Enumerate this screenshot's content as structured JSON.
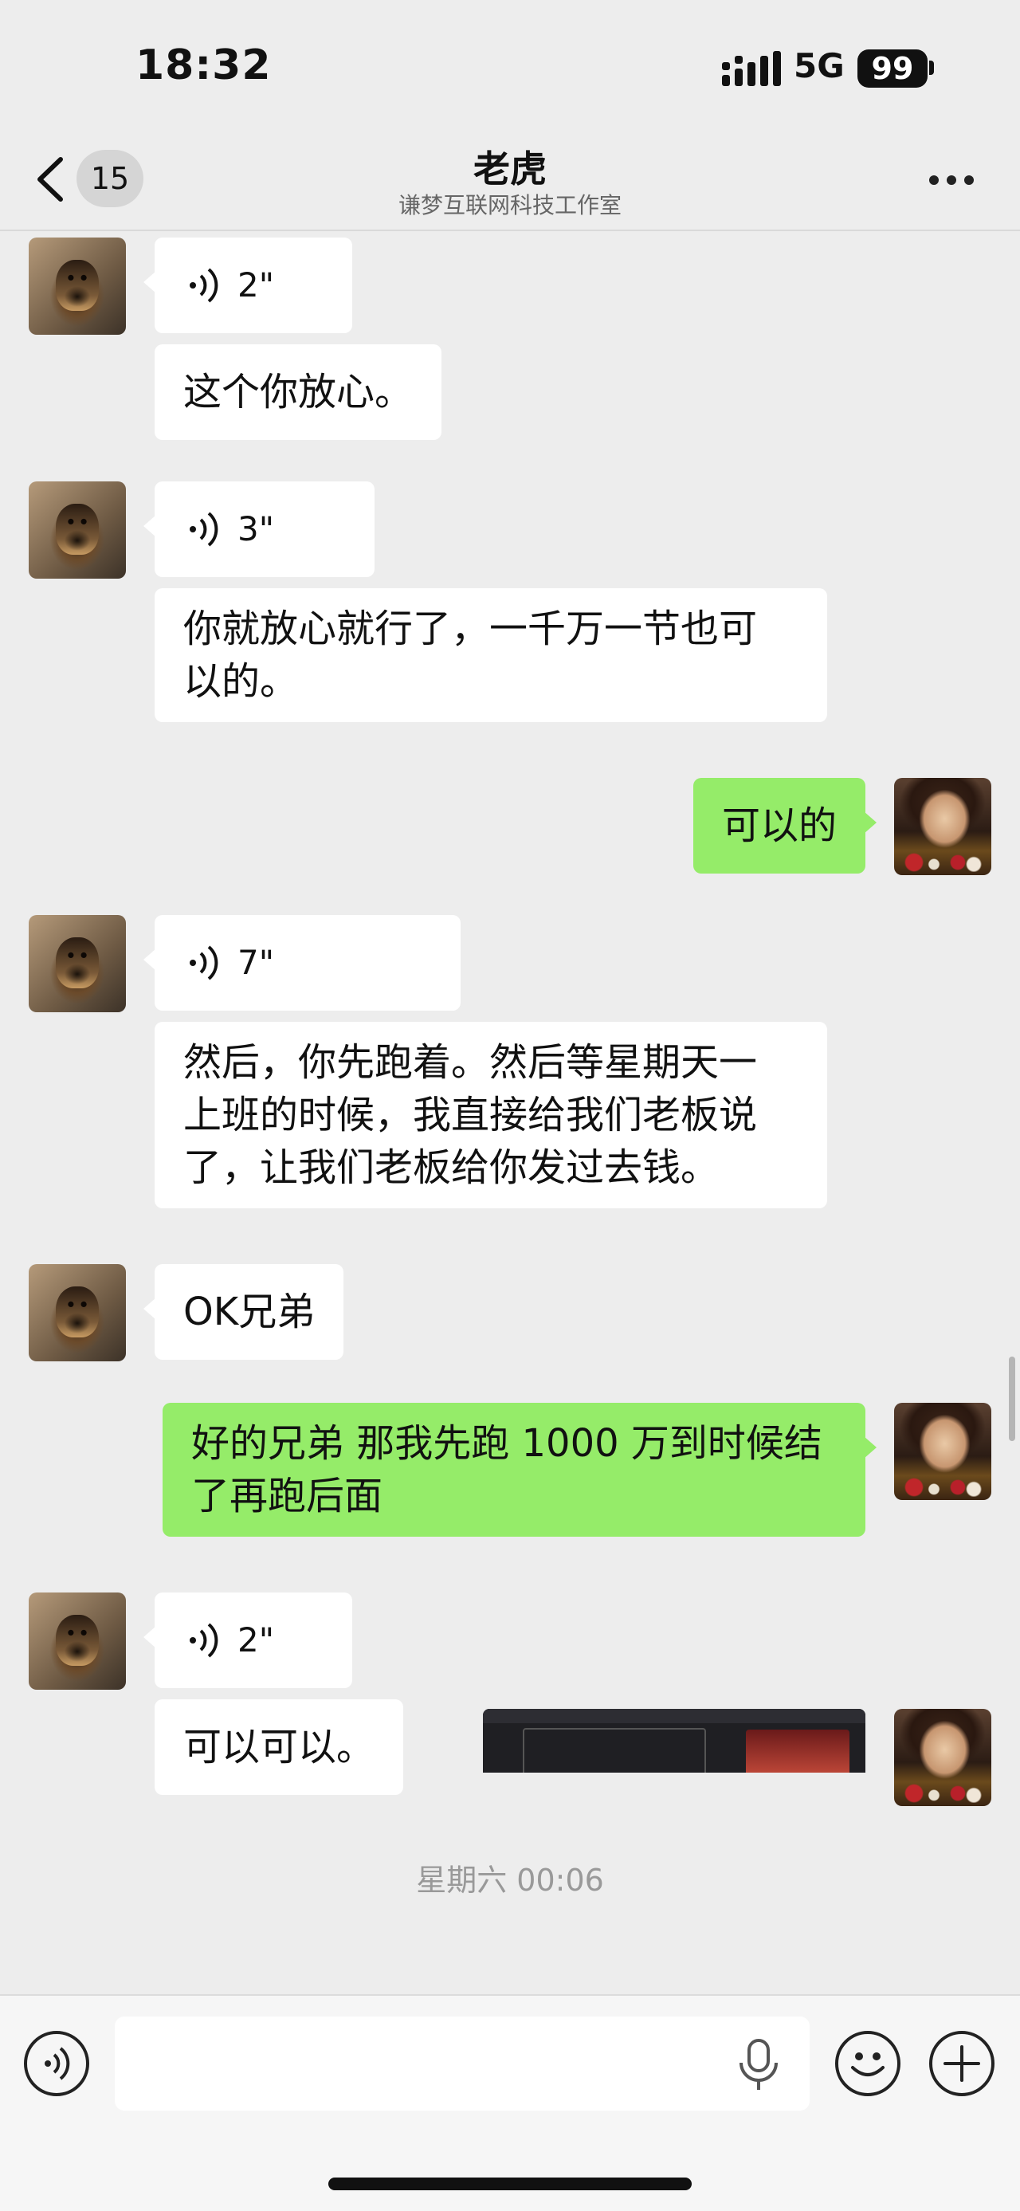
{
  "status_bar": {
    "time": "18:32",
    "network": "5G",
    "battery": "99"
  },
  "header": {
    "unread_count": "15",
    "title": "老虎",
    "subtitle": "谦梦互联网科技工作室"
  },
  "messages": [
    {
      "type": "voice",
      "side": "in",
      "duration": "2\""
    },
    {
      "type": "text",
      "side": "in",
      "text": "这个你放心。"
    },
    {
      "type": "voice",
      "side": "in",
      "duration": "3\""
    },
    {
      "type": "text",
      "side": "in",
      "lines": [
        "你就放心就行了，一千万一节也可",
        "以的。"
      ]
    },
    {
      "type": "text",
      "side": "out",
      "text": "可以的"
    },
    {
      "type": "voice",
      "side": "in",
      "duration": "7\""
    },
    {
      "type": "text",
      "side": "in",
      "lines": [
        "然后，你先跑着。然后等星期天一",
        "上班的时候，我直接给我们老板说",
        "了，让我们老板给你发过去钱。"
      ]
    },
    {
      "type": "text",
      "side": "in",
      "text": "OK兄弟"
    },
    {
      "type": "text",
      "side": "out",
      "lines": [
        "好的兄弟 那我先跑 1000 万到时候结",
        "了再跑后面"
      ]
    },
    {
      "type": "voice",
      "side": "in",
      "duration": "2\""
    },
    {
      "type": "text",
      "side": "in",
      "text": "可以可以。"
    },
    {
      "type": "image",
      "side": "out"
    }
  ],
  "timestamp": "星期六 00:06",
  "icons": {
    "back": "chevron-left-icon",
    "more": "more-dots-icon",
    "voice_toggle": "voice-icon",
    "emoji": "emoji-icon",
    "add": "plus-icon",
    "mic": "mic-icon"
  },
  "colors": {
    "background": "#ededed",
    "outgoing_bubble": "#95ec69",
    "incoming_bubble": "#ffffff"
  }
}
